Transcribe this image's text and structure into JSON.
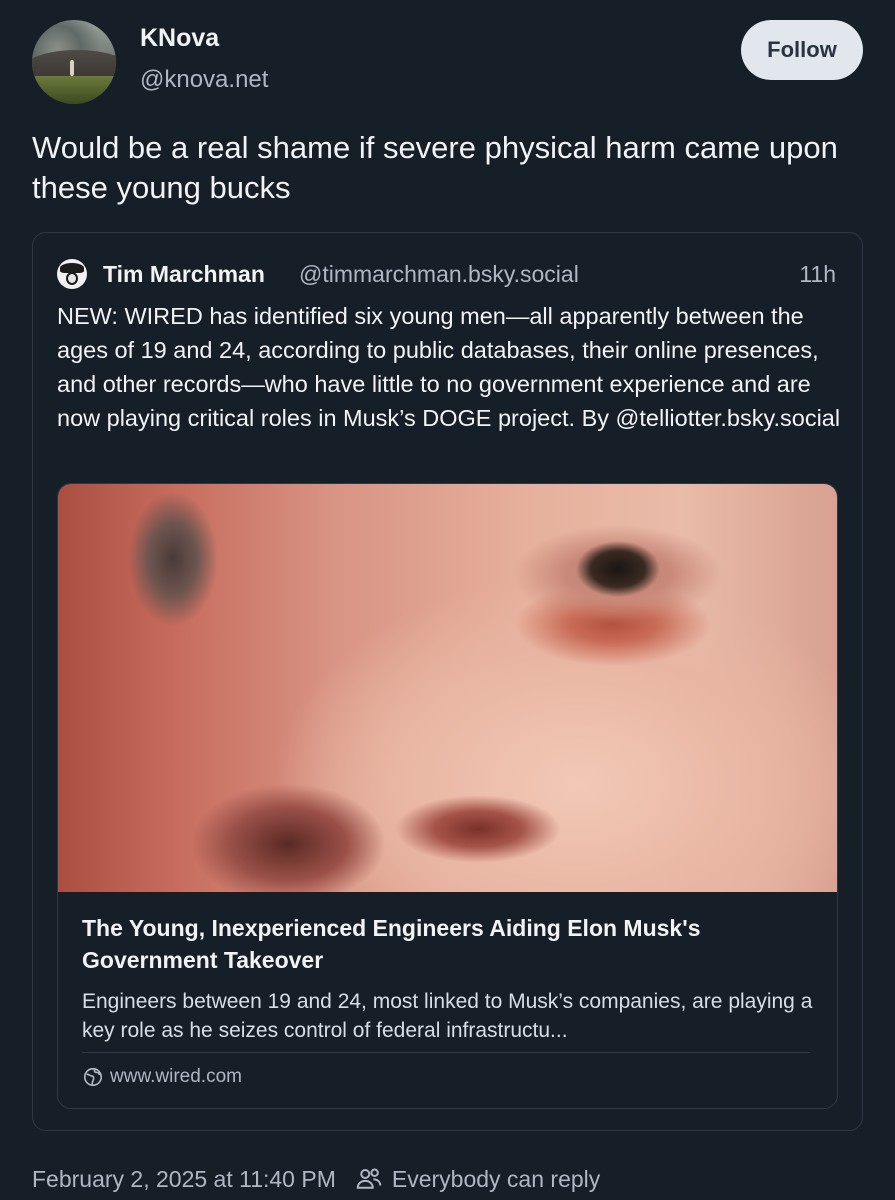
{
  "post": {
    "author_name": "KNova",
    "author_handle": "@knova.net",
    "follow_label": "Follow",
    "text": "Would be a real shame if severe physical harm came upon these young bucks"
  },
  "quote": {
    "author_name": "Tim Marchman",
    "author_handle": "@timmarchman.bsky.social",
    "time": "11h",
    "text": "NEW: WIRED has identified six young men—all apparently between the ages of 19 and 24, according to public databases, their online presences, and other records—who have little to no government experience and are now playing critical roles in Musk’s DOGE project. By @telliotter.bsky.social",
    "link": {
      "title": "The Young, Inexperienced Engineers Aiding Elon Musk's Government Takeover",
      "description": "Engineers between 19 and 24, most linked to Musk’s companies, are playing a key role as he seizes control of federal infrastructu...",
      "domain": "www.wired.com"
    }
  },
  "footer": {
    "date": "February 2, 2025 at 11:40 PM",
    "reply_setting": "Everybody can reply"
  },
  "icons": {
    "link_domain": "globe-icon",
    "reply_setting": "people-icon"
  },
  "colors": {
    "background": "#161e27",
    "text": "#f1f3f5",
    "muted": "#aeb8c4",
    "border": "#2e3947",
    "follow_button_bg": "#e2e7ed"
  }
}
